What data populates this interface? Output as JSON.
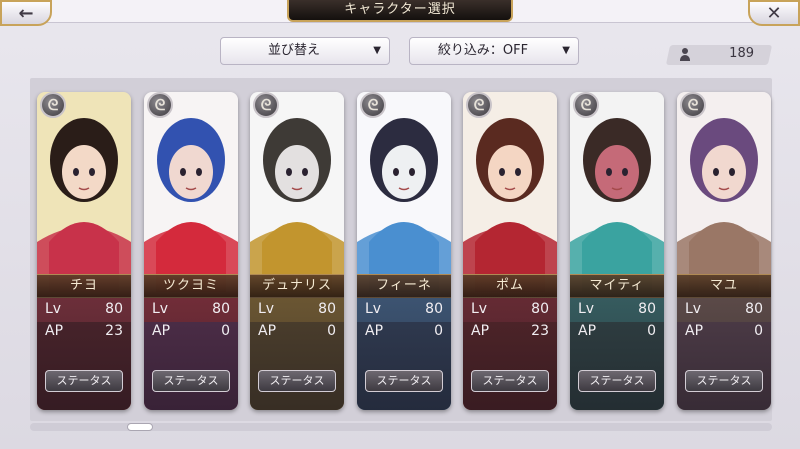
{
  "header": {
    "title": "キャラクター選択",
    "back_icon": "left-arrow-icon",
    "back_glyph": "←",
    "close_icon": "close-icon",
    "close_glyph": "✕"
  },
  "controls": {
    "sort_label": "並び替え",
    "filter_label": "絞り込み：OFF",
    "caret": "▼",
    "count": "189"
  },
  "character_badge_glyph": "ᘓ",
  "characters": [
    {
      "name": "チヨ",
      "lv_label": "Lv",
      "lv": "80",
      "ap_label": "AP",
      "ap": "23",
      "status_label": "ステータス",
      "palette": [
        "#efe4b8",
        "#c8324a",
        "#2a1d18",
        "#f3d9c7"
      ]
    },
    {
      "name": "ツクヨミ",
      "lv_label": "Lv",
      "lv": "80",
      "ap_label": "AP",
      "ap": "0",
      "status_label": "ステータス",
      "palette": [
        "#f7f4f4",
        "#d42a3c",
        "#3252b0",
        "#f0d8d0"
      ]
    },
    {
      "name": "デュナリス",
      "lv_label": "Lv",
      "lv": "80",
      "ap_label": "AP",
      "ap": "0",
      "status_label": "ステータス",
      "palette": [
        "#f6f6f6",
        "#c2952e",
        "#3e3a36",
        "#e3e0e0"
      ]
    },
    {
      "name": "フィーネ",
      "lv_label": "Lv",
      "lv": "80",
      "ap_label": "AP",
      "ap": "0",
      "status_label": "ステータス",
      "palette": [
        "#f8f8fb",
        "#4a8fd0",
        "#2c2c40",
        "#eef0f2"
      ]
    },
    {
      "name": "ポム",
      "lv_label": "Lv",
      "lv": "80",
      "ap_label": "AP",
      "ap": "23",
      "status_label": "ステータス",
      "palette": [
        "#f5eee6",
        "#b42632",
        "#5a2a20",
        "#f4d6c3"
      ]
    },
    {
      "name": "マイティ",
      "lv_label": "Lv",
      "lv": "80",
      "ap_label": "AP",
      "ap": "0",
      "status_label": "ステータス",
      "palette": [
        "#f3f3f3",
        "#3aa3a0",
        "#3a2a26",
        "#c56a78"
      ]
    },
    {
      "name": "マユ",
      "lv_label": "Lv",
      "lv": "80",
      "ap_label": "AP",
      "ap": "0",
      "status_label": "ステータス",
      "palette": [
        "#f4efef",
        "#9a7766",
        "#6a4a7e",
        "#f1d8cf"
      ]
    }
  ]
}
